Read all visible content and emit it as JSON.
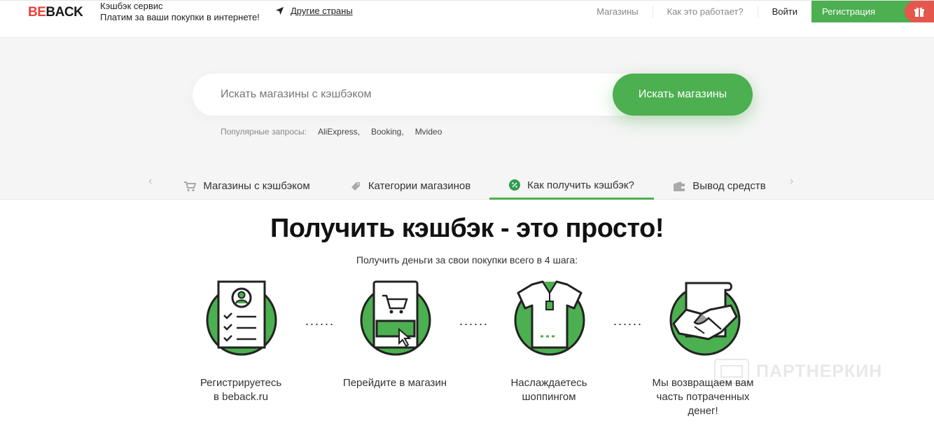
{
  "header": {
    "logo_be": "BE",
    "logo_back": "BACK",
    "tagline_line1": "Кэшбэк сервис",
    "tagline_line2": "Платим за ваши покупки в интернете!",
    "countries_link": "Другие страны",
    "nav": [
      "Магазины",
      "Как это работает?",
      "Войти"
    ],
    "register": "Регистрация"
  },
  "search": {
    "placeholder": "Искать магазины с кэшбэком",
    "button": "Искать магазины",
    "popular_label": "Популярные запросы:",
    "popular": [
      "AliExpress,",
      "Booking,",
      "Mvideo"
    ]
  },
  "tabs": [
    {
      "label": "Магазины с кэшбэком",
      "active": false
    },
    {
      "label": "Категории магазинов",
      "active": false
    },
    {
      "label": "Как получить кэшбэк?",
      "active": true
    },
    {
      "label": "Вывод средств",
      "active": false
    }
  ],
  "main": {
    "title": "Получить кэшбэк - это просто!",
    "subtitle": "Получить деньги за свои покупки всего в 4 шага:",
    "steps": [
      {
        "line1": "Регистрируетесь",
        "line2": "в beback.ru",
        "line3": ""
      },
      {
        "line1": "Перейдите в магазин",
        "line2": "",
        "line3": ""
      },
      {
        "line1": "Наслаждаетесь",
        "line2": "шоппингом",
        "line3": ""
      },
      {
        "line1": "Мы возвращаем вам",
        "line2": "часть потраченных",
        "line3": "денег!"
      }
    ],
    "dots": "......"
  },
  "watermark": "ПАРТНЕРКИН",
  "colors": {
    "accent": "#4caf50",
    "brand_red": "#e5433b"
  }
}
